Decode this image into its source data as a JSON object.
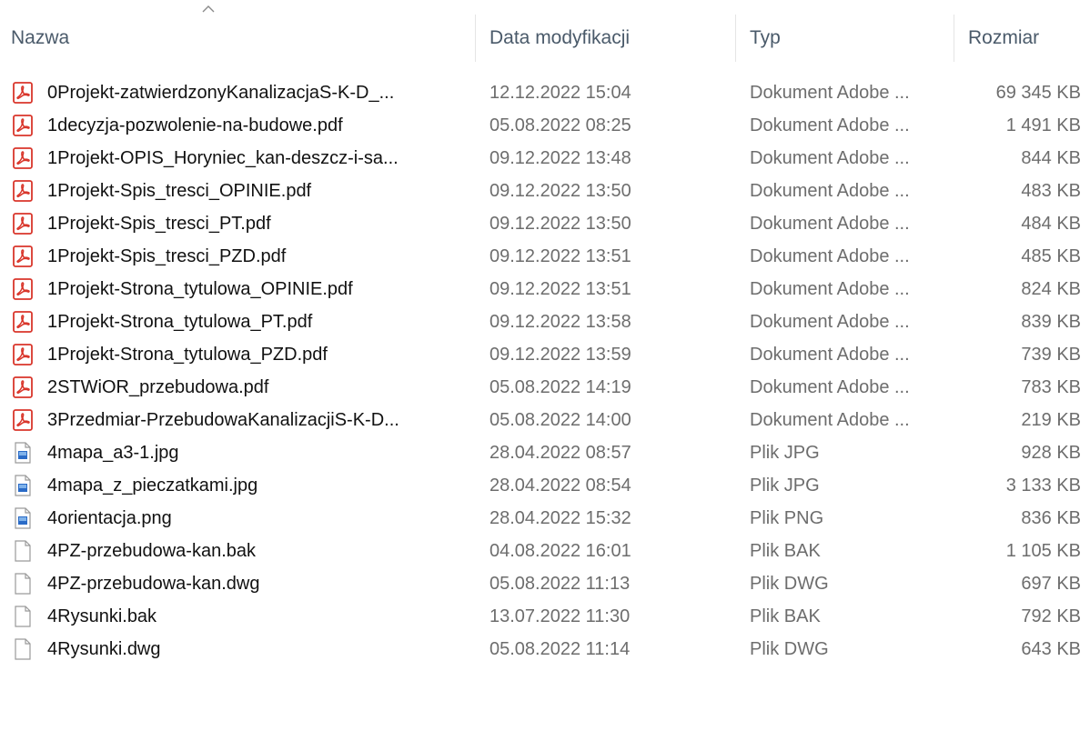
{
  "colors": {
    "header_text": "#4a5a6a",
    "pdf_red": "#d9362b",
    "image_blue": "#2a6bc7",
    "meta_text": "#6d6d6d",
    "name_text": "#111111"
  },
  "header": {
    "sort_icon": "chevron-up-icon",
    "columns": [
      {
        "key": "name",
        "label": "Nazwa"
      },
      {
        "key": "date",
        "label": "Data modyfikacji"
      },
      {
        "key": "type",
        "label": "Typ"
      },
      {
        "key": "size",
        "label": "Rozmiar"
      }
    ]
  },
  "files": [
    {
      "name": "0Projekt-zatwierdzonyKanalizacjaS-K-D_...",
      "date": "12.12.2022 15:04",
      "type": "Dokument Adobe ...",
      "size": "69 345 KB",
      "icon": "pdf"
    },
    {
      "name": "1decyzja-pozwolenie-na-budowe.pdf",
      "date": "05.08.2022 08:25",
      "type": "Dokument Adobe ...",
      "size": "1 491 KB",
      "icon": "pdf"
    },
    {
      "name": "1Projekt-OPIS_Horyniec_kan-deszcz-i-sa...",
      "date": "09.12.2022 13:48",
      "type": "Dokument Adobe ...",
      "size": "844 KB",
      "icon": "pdf"
    },
    {
      "name": "1Projekt-Spis_tresci_OPINIE.pdf",
      "date": "09.12.2022 13:50",
      "type": "Dokument Adobe ...",
      "size": "483 KB",
      "icon": "pdf"
    },
    {
      "name": "1Projekt-Spis_tresci_PT.pdf",
      "date": "09.12.2022 13:50",
      "type": "Dokument Adobe ...",
      "size": "484 KB",
      "icon": "pdf"
    },
    {
      "name": "1Projekt-Spis_tresci_PZD.pdf",
      "date": "09.12.2022 13:51",
      "type": "Dokument Adobe ...",
      "size": "485 KB",
      "icon": "pdf"
    },
    {
      "name": "1Projekt-Strona_tytulowa_OPINIE.pdf",
      "date": "09.12.2022 13:51",
      "type": "Dokument Adobe ...",
      "size": "824 KB",
      "icon": "pdf"
    },
    {
      "name": "1Projekt-Strona_tytulowa_PT.pdf",
      "date": "09.12.2022 13:58",
      "type": "Dokument Adobe ...",
      "size": "839 KB",
      "icon": "pdf"
    },
    {
      "name": "1Projekt-Strona_tytulowa_PZD.pdf",
      "date": "09.12.2022 13:59",
      "type": "Dokument Adobe ...",
      "size": "739 KB",
      "icon": "pdf"
    },
    {
      "name": "2STWiOR_przebudowa.pdf",
      "date": "05.08.2022 14:19",
      "type": "Dokument Adobe ...",
      "size": "783 KB",
      "icon": "pdf"
    },
    {
      "name": "3Przedmiar-PrzebudowaKanalizacjiS-K-D...",
      "date": "05.08.2022 14:00",
      "type": "Dokument Adobe ...",
      "size": "219 KB",
      "icon": "pdf"
    },
    {
      "name": "4mapa_a3-1.jpg",
      "date": "28.04.2022 08:57",
      "type": "Plik JPG",
      "size": "928 KB",
      "icon": "image"
    },
    {
      "name": "4mapa_z_pieczatkami.jpg",
      "date": "28.04.2022 08:54",
      "type": "Plik JPG",
      "size": "3 133 KB",
      "icon": "image"
    },
    {
      "name": "4orientacja.png",
      "date": "28.04.2022 15:32",
      "type": "Plik PNG",
      "size": "836 KB",
      "icon": "image"
    },
    {
      "name": "4PZ-przebudowa-kan.bak",
      "date": "04.08.2022 16:01",
      "type": "Plik BAK",
      "size": "1 105 KB",
      "icon": "blank"
    },
    {
      "name": "4PZ-przebudowa-kan.dwg",
      "date": "05.08.2022 11:13",
      "type": "Plik DWG",
      "size": "697 KB",
      "icon": "blank"
    },
    {
      "name": "4Rysunki.bak",
      "date": "13.07.2022 11:30",
      "type": "Plik BAK",
      "size": "792 KB",
      "icon": "blank"
    },
    {
      "name": "4Rysunki.dwg",
      "date": "05.08.2022 11:14",
      "type": "Plik DWG",
      "size": "643 KB",
      "icon": "blank"
    }
  ]
}
